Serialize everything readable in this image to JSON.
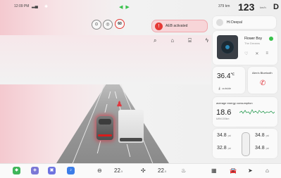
{
  "status": {
    "time": "12:09 PM",
    "range": "379 km",
    "speed": "123",
    "speed_unit": "km/h",
    "gear": "D"
  },
  "alerts": {
    "aeb_text": "AEB activated",
    "speed_limit": "60"
  },
  "greeting": "Hi Deepal",
  "music": {
    "song": "Flower Boy",
    "artist": "The Dreams"
  },
  "climate": {
    "temp": "36.4",
    "unit": "℃",
    "label": "outside"
  },
  "bluetooth": {
    "title": "Alex's Bluetooth"
  },
  "energy": {
    "title": "average energy consumption",
    "value": "18.6",
    "unit": "kWh/100km"
  },
  "tires": {
    "fl": "34.8",
    "fr": "34.8",
    "rl": "32.8",
    "rr": "34.8",
    "unit": "psi"
  },
  "bottom": {
    "temp_left": "22",
    "temp_right": "22",
    "temp_unit": ".5"
  },
  "colors": {
    "accent_red": "#e53935",
    "accent_green": "#37c14a"
  }
}
